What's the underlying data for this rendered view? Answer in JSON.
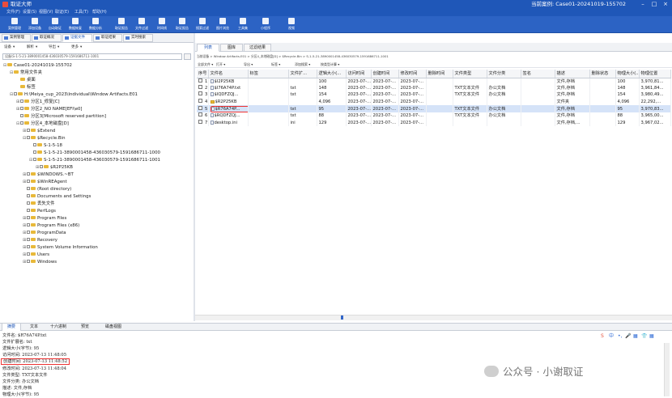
{
  "app": {
    "title": "取证大师",
    "case": "当前案例: Case01-20241019-155702"
  },
  "menu": [
    "文件(F)",
    "设置(S)",
    "视图(V)",
    "取证(E)",
    "工具(T)",
    "帮助(H)"
  ],
  "ribbon": [
    "案例管理",
    "添加设备",
    "自动取证",
    "数据恢复",
    "数据分析",
    "取证报告",
    "文件过滤",
    "时间线",
    "取证报告",
    "搜索过滤",
    "图片浏览",
    "工具集",
    "小程序",
    "视频"
  ],
  "left_tabs": [
    "案例管理",
    "取证概况",
    "证据文件",
    "取证结果",
    "实时搜索"
  ],
  "left_toolbar": [
    "设备",
    "解析",
    "导出",
    "更多"
  ],
  "path_input": "设备\\S-1-5-21-3890001458-436030579-1591686711-1001",
  "tree": [
    {
      "label": "Case01-20241019-155702",
      "level": 0,
      "toggle": "⊟",
      "checkbox": false
    },
    {
      "label": "常用文件夹",
      "level": 1,
      "toggle": "⊟",
      "checkbox": false
    },
    {
      "label": "桌面",
      "level": 2,
      "toggle": "",
      "checkbox": false
    },
    {
      "label": "标签",
      "level": 2,
      "toggle": "",
      "checkbox": false
    },
    {
      "label": "H:\\Meiya_cup_2023\\Individual\\Window Artifacts.E01",
      "level": 1,
      "toggle": "⊟",
      "checkbox": true
    },
    {
      "label": "分区1_修复[C]",
      "level": 2,
      "toggle": "⊞",
      "checkbox": true
    },
    {
      "label": "分区2_NO NAME[EFI\\e0]",
      "level": 2,
      "toggle": "⊞",
      "checkbox": true
    },
    {
      "label": "分区3[Microsoft reserved partition]",
      "level": 2,
      "toggle": "",
      "checkbox": true
    },
    {
      "label": "分区4_本地磁盘[D]",
      "level": 2,
      "toggle": "⊟",
      "checkbox": true
    },
    {
      "label": "$Extend",
      "level": 3,
      "toggle": "⊞",
      "checkbox": true
    },
    {
      "label": "$Recycle.Bin",
      "level": 3,
      "toggle": "⊟",
      "checkbox": true
    },
    {
      "label": "S-1-5-18",
      "level": 4,
      "toggle": "",
      "checkbox": true
    },
    {
      "label": "S-1-5-21-3890001458-436030579-1591686711-1000",
      "level": 4,
      "toggle": "",
      "checkbox": true
    },
    {
      "label": "S-1-5-21-3890001458-436030579-1591686711-1001",
      "level": 4,
      "toggle": "⊟",
      "checkbox": true
    },
    {
      "label": "$R2P25KB",
      "level": 5,
      "toggle": "⊞",
      "checkbox": true
    },
    {
      "label": "$WINDOWS.~BT",
      "level": 3,
      "toggle": "⊞",
      "checkbox": true
    },
    {
      "label": "$WinREAgent",
      "level": 3,
      "toggle": "⊞",
      "checkbox": true
    },
    {
      "label": "(Root directory)",
      "level": 3,
      "toggle": "",
      "checkbox": true
    },
    {
      "label": "Documents and Settings",
      "level": 3,
      "toggle": "",
      "checkbox": true
    },
    {
      "label": "丢失文件",
      "level": 3,
      "toggle": "",
      "checkbox": true
    },
    {
      "label": "PerfLogs",
      "level": 3,
      "toggle": "",
      "checkbox": true
    },
    {
      "label": "Program Files",
      "level": 3,
      "toggle": "⊞",
      "checkbox": true
    },
    {
      "label": "Program Files (x86)",
      "level": 3,
      "toggle": "⊞",
      "checkbox": true
    },
    {
      "label": "ProgramData",
      "level": 3,
      "toggle": "⊞",
      "checkbox": true
    },
    {
      "label": "Recovery",
      "level": 3,
      "toggle": "⊞",
      "checkbox": true
    },
    {
      "label": "System Volume Information",
      "level": 3,
      "toggle": "⊞",
      "checkbox": true
    },
    {
      "label": "Users",
      "level": 3,
      "toggle": "⊞",
      "checkbox": true
    },
    {
      "label": "Windows",
      "level": 3,
      "toggle": "⊞",
      "checkbox": true
    }
  ],
  "right_tabs": [
    "列表",
    "图库",
    "过滤结果"
  ],
  "breadcrumb": "当前设备 > Window Artifacts.E01 > 分区4_本地磁盘[D] > $Recycle.Bin > S-1-5-21-3890001458-436030579-1591686711-1001",
  "file_toolbar": [
    "全部文件 ▾",
    "打开 ▾",
    "导出 ▾",
    "标签 ▾",
    "添加搜索 ▾",
    "按类型计算 ▾"
  ],
  "columns": [
    "序号",
    "文件名",
    "标签",
    "文件扩...",
    "逻辑大小(...",
    "访问时间",
    "创建时间",
    "修改时间",
    "删除时间",
    "文件类型",
    "文件分类",
    "签名",
    "描述",
    "删除状态",
    "物理大小(...",
    "物理位置"
  ],
  "rows": [
    {
      "no": "1",
      "name": "$I2P25KB",
      "tag": "",
      "ext": "",
      "size": "100",
      "atime": "2023-07-...",
      "ctime": "2023-07-...",
      "mtime": "2023-07-...",
      "dtime": "",
      "ftype": "",
      "fcat": "",
      "sig": "",
      "desc": "文件,存档",
      "dstate": "",
      "psize": "100",
      "loc": "3,970,81...",
      "selected": false,
      "folder": false,
      "highlight": false
    },
    {
      "no": "2",
      "name": "$I76A74P.txt",
      "tag": "",
      "ext": "txt",
      "size": "148",
      "atime": "2023-07-...",
      "ctime": "2023-07-...",
      "mtime": "2023-07-...",
      "dtime": "",
      "ftype": "TXT文本文件",
      "fcat": "办公文档",
      "sig": "",
      "desc": "文件,存档",
      "dstate": "",
      "psize": "148",
      "loc": "3,961,84...",
      "selected": false,
      "folder": false,
      "highlight": false
    },
    {
      "no": "3",
      "name": "$IQDFZQJ...",
      "tag": "",
      "ext": "txt",
      "size": "154",
      "atime": "2023-07-...",
      "ctime": "2023-07-...",
      "mtime": "2023-07-...",
      "dtime": "",
      "ftype": "TXT文本文件",
      "fcat": "办公文档",
      "sig": "",
      "desc": "文件,存档",
      "dstate": "",
      "psize": "154",
      "loc": "3,980,49...",
      "selected": false,
      "folder": false,
      "highlight": false
    },
    {
      "no": "4",
      "name": "$R2P25KB",
      "tag": "",
      "ext": "",
      "size": "4,096",
      "atime": "2023-07-...",
      "ctime": "2023-07-...",
      "mtime": "2023-07-...",
      "dtime": "",
      "ftype": "",
      "fcat": "",
      "sig": "",
      "desc": "文件夹",
      "dstate": "",
      "psize": "4,096",
      "loc": "22,292,...",
      "selected": false,
      "folder": true,
      "highlight": false
    },
    {
      "no": "5",
      "name": "$R76A74P...",
      "tag": "",
      "ext": "txt",
      "size": "95",
      "atime": "2023-07-...",
      "ctime": "2023-07-...",
      "mtime": "2023-07-...",
      "dtime": "",
      "ftype": "TXT文本文件",
      "fcat": "办公文档",
      "sig": "",
      "desc": "文件,存档",
      "dstate": "",
      "psize": "95",
      "loc": "3,970,83...",
      "selected": true,
      "folder": false,
      "highlight": true
    },
    {
      "no": "6",
      "name": "$RQDFZQJ...",
      "tag": "",
      "ext": "txt",
      "size": "88",
      "atime": "2023-07-...",
      "ctime": "2023-07-...",
      "mtime": "2023-07-...",
      "dtime": "",
      "ftype": "TXT文本文件",
      "fcat": "办公文档",
      "sig": "",
      "desc": "文件,存档",
      "dstate": "",
      "psize": "88",
      "loc": "3,965,00...",
      "selected": false,
      "folder": false,
      "highlight": false
    },
    {
      "no": "7",
      "name": "desktop.ini",
      "tag": "",
      "ext": "ini",
      "size": "129",
      "atime": "2023-07-...",
      "ctime": "2023-07-...",
      "mtime": "2023-07-...",
      "dtime": "",
      "ftype": "",
      "fcat": "",
      "sig": "",
      "desc": "文件,存档,...",
      "dstate": "",
      "psize": "129",
      "loc": "3,967,02...",
      "selected": false,
      "folder": false,
      "highlight": false
    }
  ],
  "bottom_tabs": [
    "摘要",
    "文本",
    "十六进制",
    "预览",
    "磁盘视图"
  ],
  "detail": [
    "文件名: $R76A74P.txt",
    "文件扩展名: txt",
    "逻辑大小(字节): 95",
    "访问时间: 2023-07-13 11:48:05",
    "创建时间: 2023-07-13 11:48:52",
    "修改时间: 2023-07-13 11:48:04",
    "文件类型: TXT文本文件",
    "文件分类: 办公文档",
    "描述: 文件,存档",
    "物理大小(字节): 95"
  ],
  "ime_bar": [
    "S",
    "中",
    "•,",
    "🎤",
    "▦",
    "👕",
    "▦"
  ],
  "watermark": "公众号 · 小谢取证",
  "colors": {
    "titlebar": "#1f57b8",
    "ribbon": "#2c63c4",
    "selection": "#d5e3f8",
    "highlight_box": "#e33333"
  }
}
